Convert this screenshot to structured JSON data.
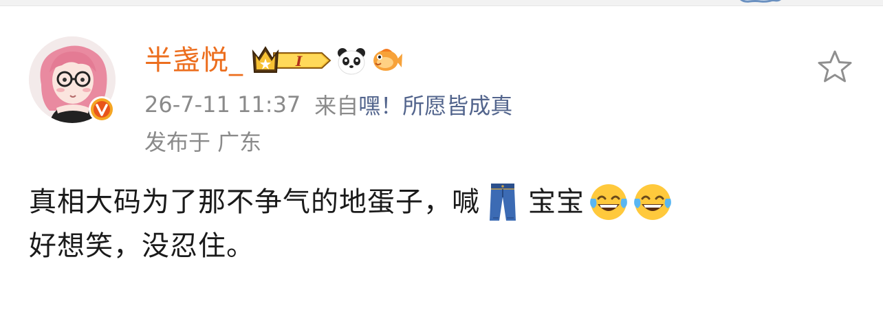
{
  "post": {
    "username": "半盏悦_",
    "badge_level": "I",
    "timestamp": "26-7-11 11:37",
    "from_prefix": "来自",
    "source": "嘿！所愿皆成真",
    "location": "发布于 广东",
    "content_line1_text": "真相大码为了那不争气的地蛋子，喊",
    "content_line1_text2": "宝宝",
    "content_line2": "好想笑，没忍住。"
  },
  "icons": {
    "avatar": "avatar-illustration",
    "verified": "verified-v-badge",
    "crown_badge": "crown-level-badge",
    "panda": "panda-emoji",
    "fish": "goldfish-emoji",
    "star": "star-outline-icon",
    "jeans": "jeans-emoji",
    "laugh": "tears-of-joy-emoji"
  },
  "colors": {
    "username": "#ec6e1e",
    "meta_gray": "#8a8a8a",
    "source_link": "#52648c",
    "text": "#1a1a1a",
    "verified": "#f5a623"
  }
}
